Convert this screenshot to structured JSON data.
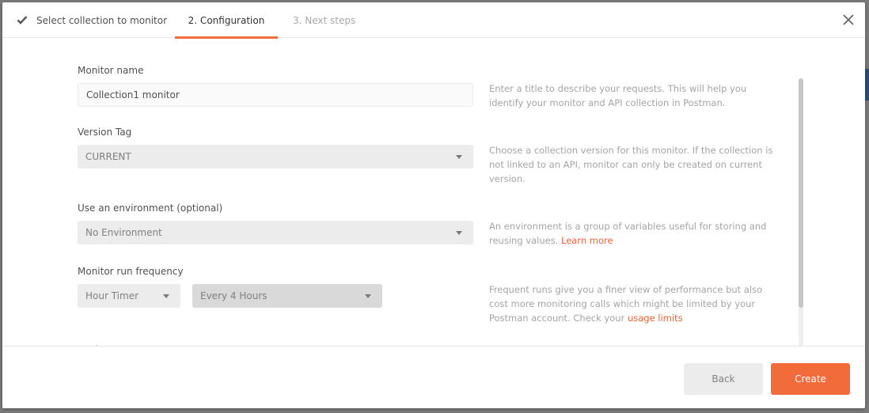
{
  "stepper": {
    "steps": [
      {
        "label": "Select collection to monitor",
        "state": "completed",
        "icon": "check-icon"
      },
      {
        "label": "2. Configuration",
        "state": "active"
      },
      {
        "label": "3. Next steps",
        "state": "upcoming"
      }
    ],
    "close_icon": "close-icon"
  },
  "form": {
    "monitor_name": {
      "label": "Monitor name",
      "value": "Collection1 monitor",
      "help": "Enter a title to describe your requests. This will help you identify your monitor and API collection in Postman."
    },
    "version_tag": {
      "label": "Version Tag",
      "selected": "CURRENT",
      "help": "Choose a collection version for this monitor. If the collection is not linked to an API, monitor can only be created on current version."
    },
    "environment": {
      "label": "Use an environment (optional)",
      "selected": "No Environment",
      "help_text": "An environment is a group of variables useful for storing and reusing values. ",
      "help_link": "Learn more"
    },
    "frequency": {
      "label": "Monitor run frequency",
      "timer_type": "Hour Timer",
      "interval": "Every 4 Hours",
      "help_text": "Frequent runs give you a finer view of performance but also cost more monitoring calls which might be limited by your Postman account. Check your ",
      "help_link": "usage limits"
    },
    "next_section_label_partial": "Regi"
  },
  "footer": {
    "back_label": "Back",
    "create_label": "Create"
  },
  "colors": {
    "accent": "#f26b3a",
    "link": "#e8623a"
  }
}
